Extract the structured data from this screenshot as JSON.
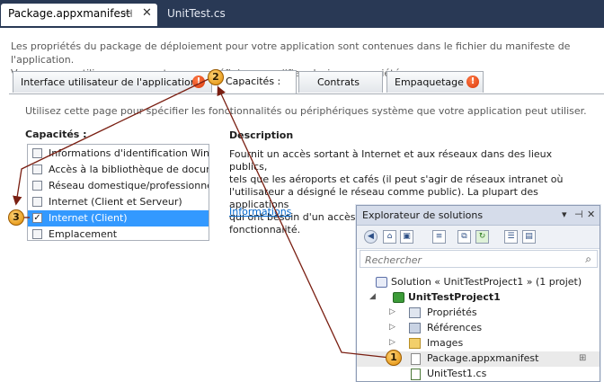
{
  "doc_tabs": [
    {
      "label": "Package.appxmanifest",
      "pin": "⊣",
      "close": "✕"
    },
    {
      "label": "UnitTest.cs"
    }
  ],
  "intro": {
    "line1": "Les propriétés du package de déploiement pour votre application sont contenues dans le fichier du manifeste de l'application.",
    "line2": "Vous pouvez utiliser ce concepteur pour définir ou modifier plusieurs propriétés."
  },
  "designer_tabs": [
    {
      "label": "Interface utilisateur de l'application",
      "warning": true
    },
    {
      "label": "Capacités :",
      "active": true
    },
    {
      "label": "Contrats"
    },
    {
      "label": "Empaquetage",
      "warning": true
    }
  ],
  "usage_text": "Utilisez cette page pour spécifier les fonctionnalités ou périphériques système que votre application peut utiliser.",
  "capabilities": {
    "title": "Capacités :",
    "items": [
      {
        "label": "Informations d'identification Win...",
        "checked": false
      },
      {
        "label": "Accès à la bibliothèque de docum...",
        "checked": false
      },
      {
        "label": "Réseau domestique/professionnel",
        "checked": false
      },
      {
        "label": "Internet (Client et Serveur)",
        "checked": false
      },
      {
        "label": "Internet (Client)",
        "checked": true,
        "selected": true
      },
      {
        "label": "Emplacement",
        "checked": false
      }
    ]
  },
  "description": {
    "title": "Description",
    "lines": [
      "Fournit un accès sortant à Internet et aux réseaux dans des lieux publics,",
      "tels que les aéroports et cafés (il peut s'agir de réseaux intranet où",
      "l'utilisateur a désigné le réseau comme public). La plupart des applications",
      "qui ont besoin d'un accès à Internet devraient utiliser cette fonctionnalité."
    ],
    "link": "Informations"
  },
  "solution_explorer": {
    "title": "Explorateur de solutions",
    "controls": {
      "dropdown": "▾",
      "pin": "⊣",
      "close": "✕"
    },
    "search_placeholder": "Rechercher",
    "tree": [
      {
        "label": "Solution « UnitTestProject1 » (1 projet)",
        "icon": "solution-icon"
      },
      {
        "label": "UnitTestProject1",
        "icon": "csharp-project-icon",
        "bold": true,
        "expander": "◢"
      },
      {
        "label": "Propriétés",
        "icon": "properties-icon",
        "expander": "▷"
      },
      {
        "label": "Références",
        "icon": "references-icon",
        "expander": "▷"
      },
      {
        "label": "Images",
        "icon": "folder-icon",
        "expander": "▷"
      },
      {
        "label": "Package.appxmanifest",
        "icon": "manifest-file-icon",
        "highlighted": true
      },
      {
        "label": "UnitTest1.cs",
        "icon": "csharp-file-icon"
      }
    ]
  },
  "callouts": [
    "1",
    "2",
    "3"
  ],
  "colors": {
    "tab_strip": "#293955",
    "selection": "#3399ff",
    "link": "#0066cc",
    "arrow": "#7a1f12",
    "callout": "#f2a400",
    "warning": "#e0450f"
  }
}
